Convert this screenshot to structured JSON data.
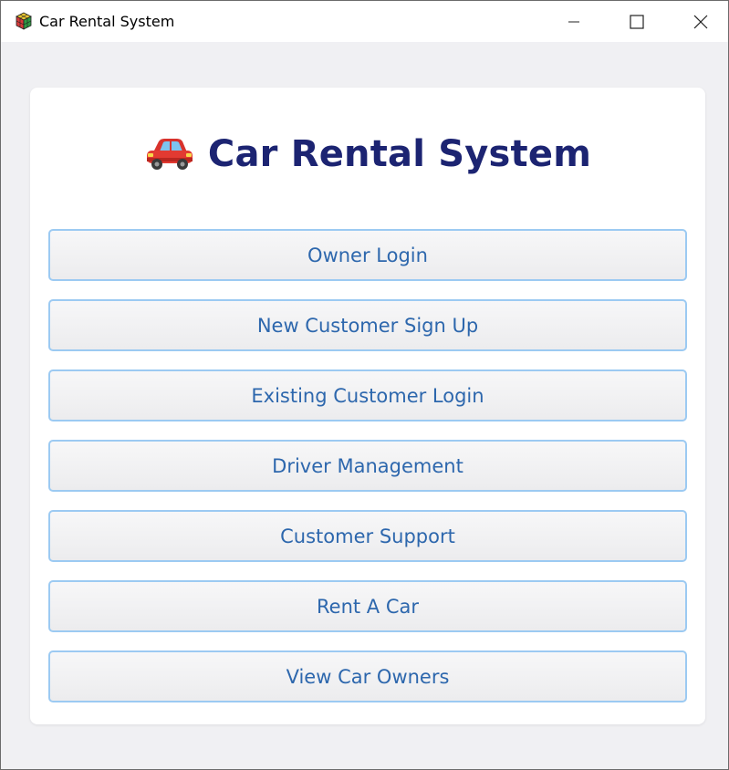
{
  "window": {
    "title": "Car Rental System",
    "app_icon": "rubiks-cube-icon",
    "controls": [
      "minimize-icon",
      "maximize-icon",
      "close-icon"
    ]
  },
  "main": {
    "heading_icon": "car-icon",
    "heading": "Car Rental System",
    "buttons": [
      {
        "label": "Owner Login"
      },
      {
        "label": "New Customer Sign Up"
      },
      {
        "label": "Existing Customer Login"
      },
      {
        "label": "Driver Management"
      },
      {
        "label": "Customer Support"
      },
      {
        "label": "Rent A Car"
      },
      {
        "label": "View Car Owners"
      }
    ]
  },
  "colors": {
    "heading": "#1c2472",
    "button_text": "#2d67ad",
    "button_border": "#9ccaf2",
    "background": "#f0f0f3"
  }
}
